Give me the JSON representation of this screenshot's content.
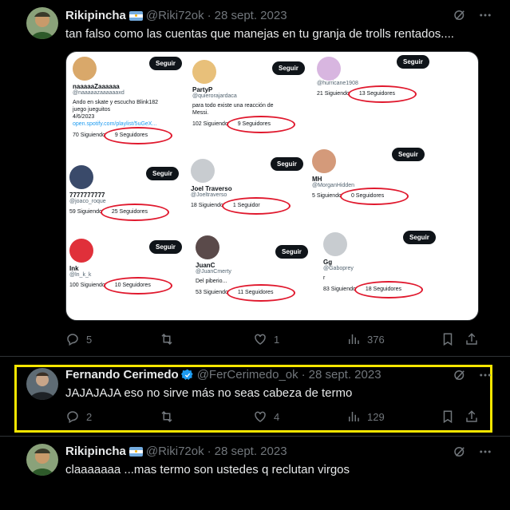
{
  "tweets": [
    {
      "name": "Rikipincha",
      "handle": "@Riki72ok",
      "date": "28 sept. 2023",
      "text": "tan falso como las cuentas que manejas en tu granja de trolls rentados....",
      "replies": "5",
      "reposts": "",
      "likes": "1",
      "views": "376"
    },
    {
      "name": "Fernando Cerimedo",
      "handle": "@FerCerimedo_ok",
      "date": "28 sept. 2023",
      "text": "JAJAJAJA eso no sirve más no seas cabeza de termo",
      "replies": "2",
      "reposts": "",
      "likes": "4",
      "views": "129"
    },
    {
      "name": "Rikipincha",
      "handle": "@Riki72ok",
      "date": "28 sept. 2023",
      "text": "claaaaaaa ...mas termo son ustedes q reclutan virgos"
    }
  ],
  "media": {
    "follow_label": "Seguir",
    "cards": [
      {
        "name": "naaaaaZaaaaaa",
        "handle": "@naaaaazaaaaaaxd",
        "bio": [
          "Ando en skate y escucho Blink182",
          "juego jueguitos",
          "4/6/2023"
        ],
        "link": "open.spotify.com/playlist/5uGeX...",
        "following": "70 Siguiendo",
        "followers": "9 Seguidores"
      },
      {
        "name": "PartyP",
        "handle": "@quierorajardaca",
        "bio": [
          "para todo existe una reacción de",
          "Messi."
        ],
        "link": "",
        "following": "102 Siguiendo",
        "followers": "9 Seguidores"
      },
      {
        "name": "",
        "handle": "@hurricane1908",
        "bio": [],
        "link": "",
        "following": "21 Siguiendo",
        "followers": "13 Seguidores"
      },
      {
        "name": "7777777777",
        "handle": "@joaco_roque",
        "bio": [],
        "link": "",
        "following": "59 Siguiendo",
        "followers": "25 Seguidores"
      },
      {
        "name": "Joel Traverso",
        "handle": "@Joeltraverso",
        "bio": [],
        "link": "",
        "following": "18 Siguiendo",
        "followers": "1 Seguidor"
      },
      {
        "name": "MH",
        "handle": "@MorganHidden",
        "bio": [],
        "link": "",
        "following": "5 Siguiendo",
        "followers": "0 Seguidores"
      },
      {
        "name": "Ink",
        "handle": "@ln_k_k",
        "bio": [],
        "link": "",
        "following": "100 Siguiendo",
        "followers": "10 Seguidores"
      },
      {
        "name": "JuanC",
        "handle": "@JuanCmerty",
        "bio": [
          "Del piberio..."
        ],
        "link": "",
        "following": "53 Siguiendo",
        "followers": "11 Seguidores"
      },
      {
        "name": "Gg",
        "handle": "@Gaboprey",
        "bio": [
          "r"
        ],
        "link": "",
        "following": "83 Siguiendo",
        "followers": "18 Seguidores"
      }
    ]
  },
  "colors": {
    "background": "#000000",
    "text": "#e7e9ea",
    "muted": "#71767b",
    "highlight": "#f7e600",
    "verified": "#1d9bf0",
    "ring": "#e0182d"
  },
  "icons": [
    "grok-icon",
    "more-icon",
    "reply-icon",
    "repost-icon",
    "like-icon",
    "views-icon",
    "bookmark-icon",
    "share-icon"
  ]
}
